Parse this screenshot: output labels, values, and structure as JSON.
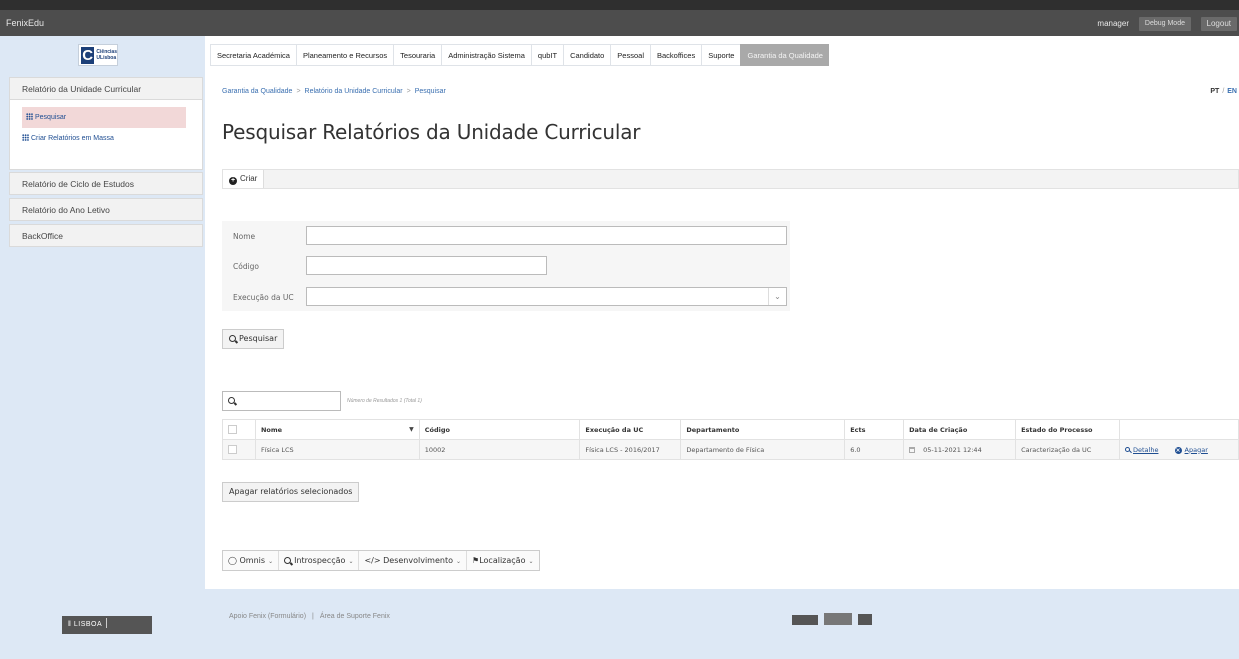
{
  "topbar": {
    "brand": "FenixEdu",
    "user": "manager",
    "debug_label": "Debug Mode",
    "logout_label": "Logout"
  },
  "logo": {
    "letter": "C",
    "line1": "Ciências",
    "line2": "ULisboa"
  },
  "sidebar": {
    "active_section": "Relatório da Unidade Curricular",
    "links": [
      "Pesquisar",
      "Criar Relatórios em Massa"
    ],
    "sections": [
      "Relatório de Ciclo de Estudos",
      "Relatório do Ano Letivo",
      "BackOffice"
    ]
  },
  "nav": {
    "items": [
      "Secretaria Académica",
      "Planeamento e Recursos",
      "Tesouraria",
      "Administração Sistema",
      "qubIT",
      "Candidato",
      "Pessoal",
      "Backoffices",
      "Suporte",
      "Garantia da Qualidade"
    ]
  },
  "breadcrumb": [
    "Garantia da Qualidade",
    "Relatório da Unidade Curricular",
    "Pesquisar"
  ],
  "breadcrumb_sep": ">",
  "lang": {
    "pt": "PT",
    "sep": "/",
    "en": "EN"
  },
  "page_title": "Pesquisar Relatórios da Unidade Curricular",
  "criar_label": "Criar",
  "form": {
    "nome_label": "Nome",
    "nome_value": "",
    "codigo_label": "Código",
    "codigo_value": "",
    "execucao_label": "Execução da UC",
    "execucao_value": ""
  },
  "search_button": "Pesquisar",
  "results_note": "Número de Resultados 1 (Total 1)",
  "table": {
    "headers": [
      "Nome",
      "Código",
      "Execução da UC",
      "Departamento",
      "Ects",
      "Data de Criação",
      "Estado do Processo"
    ],
    "rows": [
      {
        "nome": "Física LCS",
        "codigo": "10002",
        "execucao": "Física LCS - 2016/2017",
        "departamento": "Departamento de Física",
        "ects": "6.0",
        "data": "05-11-2021 12:44",
        "estado": "Caracterização da UC",
        "detalhe": "Detalhe",
        "apagar": "Apagar"
      }
    ]
  },
  "delete_selected": "Apagar relatórios selecionados",
  "devbar": {
    "omnis": "Omnis",
    "introspeccao": "Introspecção",
    "desenvolvimento": "Desenvolvimento",
    "localizacao": "Localização",
    "dev_glyph": "</>"
  },
  "footer": {
    "logo_text": "LISBOA",
    "link1": "Apoio Fenix (Formulário)",
    "sep": "|",
    "link2": "Área de Suporte Fenix"
  }
}
